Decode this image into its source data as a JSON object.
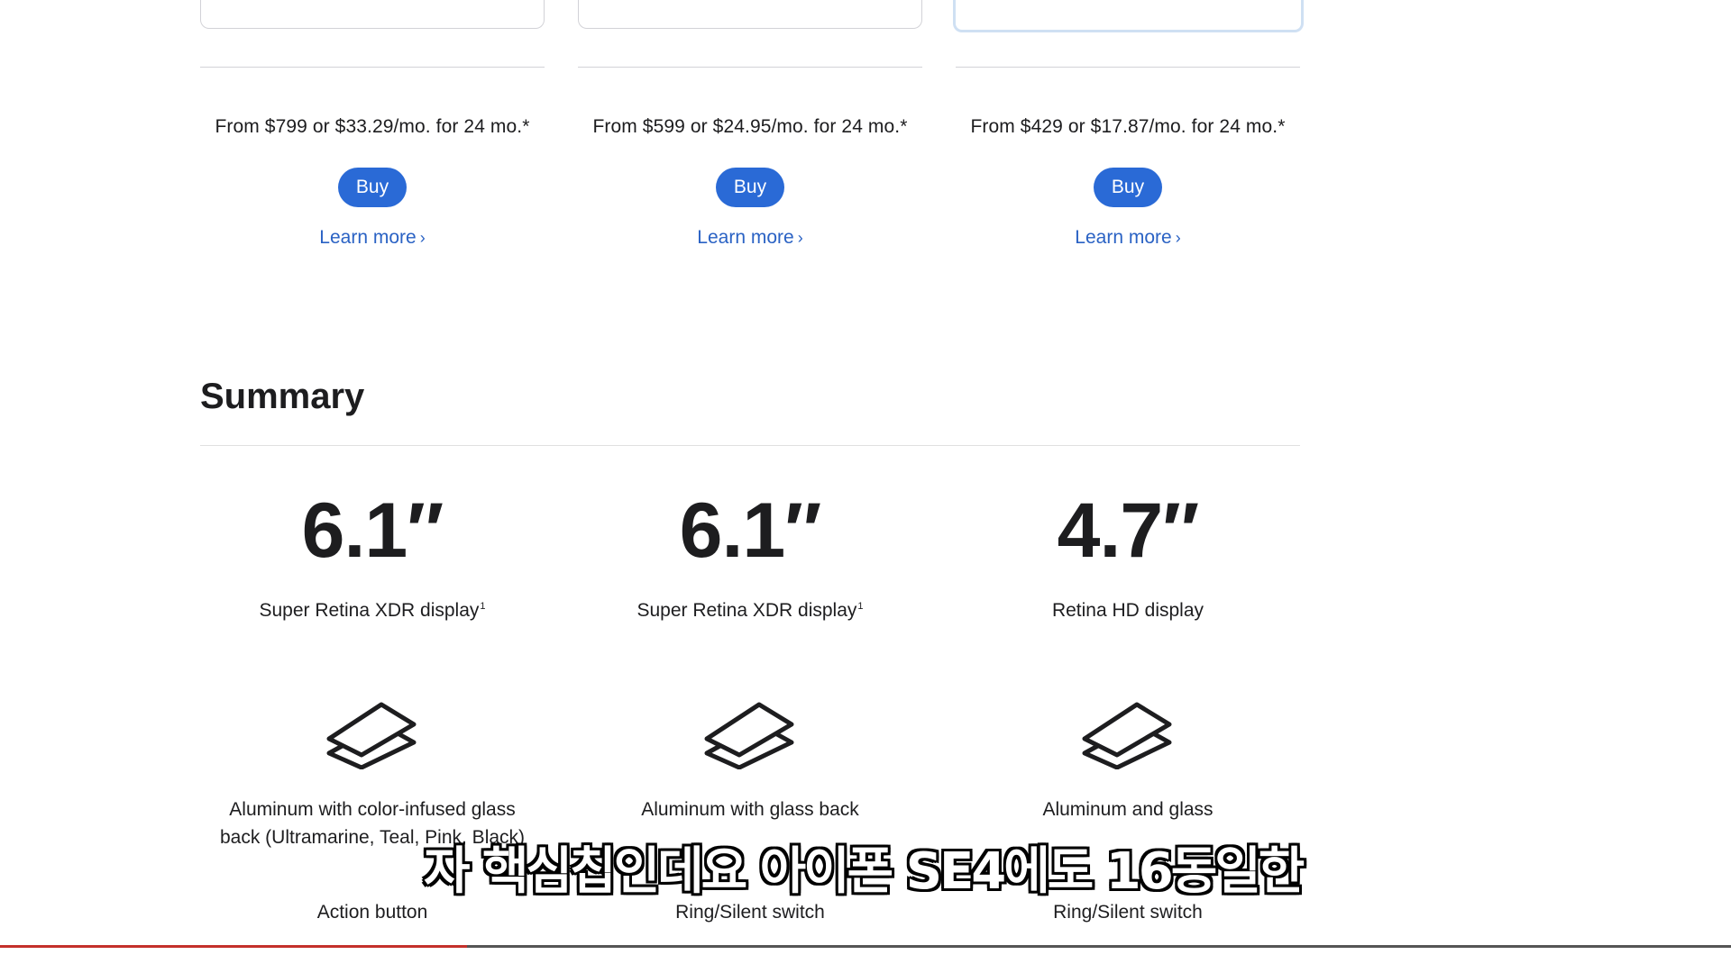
{
  "columns": [
    {
      "price": "From $799 or $33.29/mo. for 24 mo.*",
      "buy_label": "Buy",
      "learn_more": "Learn more",
      "size": "6.1″",
      "display": "Super Retina XDR display",
      "display_footnote": "1",
      "material": "Aluminum with color-infused glass back (Ultramarine, Teal, Pink, Black)",
      "feature": "Action button",
      "selected": false
    },
    {
      "price": "From $599 or $24.95/mo. for 24 mo.*",
      "buy_label": "Buy",
      "learn_more": "Learn more",
      "size": "6.1″",
      "display": "Super Retina XDR display",
      "display_footnote": "1",
      "material": "Aluminum with glass back",
      "feature": "Ring/Silent switch",
      "selected": false
    },
    {
      "price": "From $429 or $17.87/mo. for 24 mo.*",
      "buy_label": "Buy",
      "learn_more": "Learn more",
      "size": "4.7″",
      "display": "Retina HD display",
      "display_footnote": "",
      "material": "Aluminum and glass",
      "feature": "Ring/Silent switch",
      "selected": true
    }
  ],
  "summary": {
    "title": "Summary"
  },
  "icons": {
    "chevron": "chevron-right-icon",
    "material": "stacked-layers-icon"
  },
  "subtitle": "자 핵심칩인데요 아이폰 SE4에도 16동일한",
  "video": {
    "progress": 0.27
  },
  "colors": {
    "accent": "#2a6ad6",
    "link": "#2a62c4",
    "progress": "#c4302b"
  }
}
